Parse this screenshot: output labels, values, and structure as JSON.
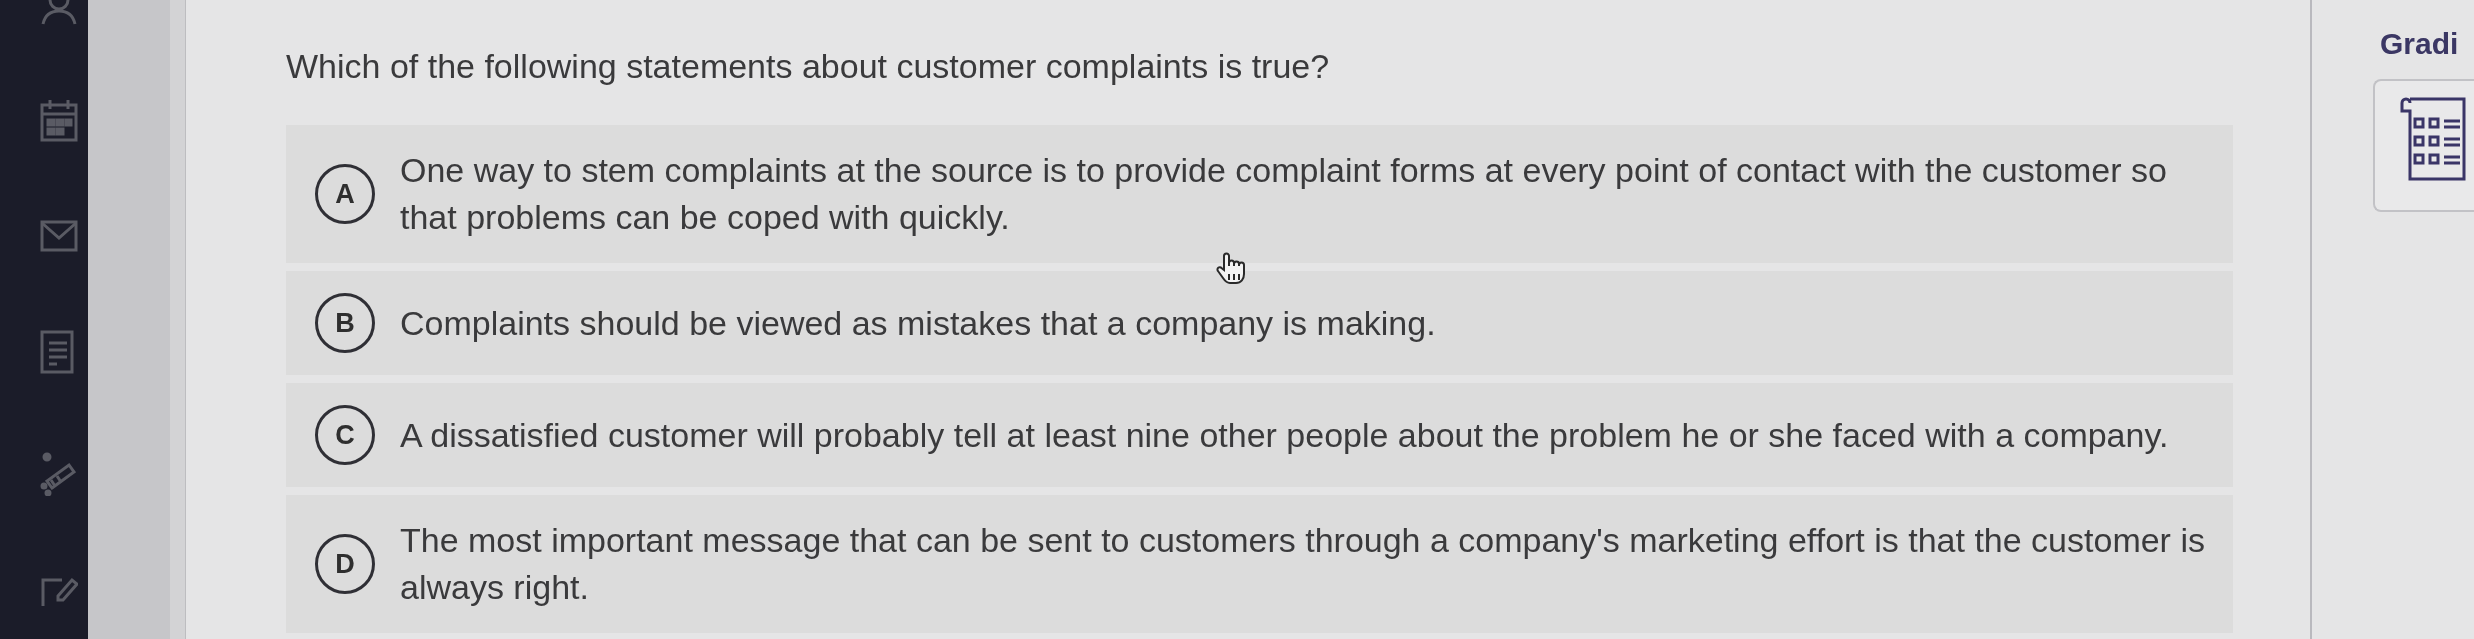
{
  "question": "Which of the following statements about customer complaints is true?",
  "options": [
    {
      "letter": "A",
      "text": "One way to stem complaints at the source is to provide complaint forms at every point of contact with the customer so that problems can be coped with quickly.",
      "selected": false
    },
    {
      "letter": "B",
      "text": "Complaints should be viewed as mistakes that a company is making.",
      "selected": false
    },
    {
      "letter": "C",
      "text": "A dissatisfied customer will probably tell at least nine other people about the problem he or she faced with a company.",
      "selected": false
    },
    {
      "letter": "D",
      "text": "The most important message that can be sent to customers through a company's marketing effort is that the customer is always right.",
      "selected": false
    }
  ],
  "right_panel": {
    "heading": "Gradi"
  }
}
